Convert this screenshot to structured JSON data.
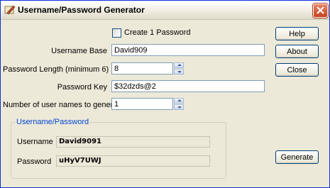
{
  "window": {
    "title": "Username/Password Generator"
  },
  "form": {
    "create_one_label": "Create 1 Password",
    "username_base_label": "Username Base",
    "username_base_value": "David909",
    "password_length_label": "Password Length (minimum 6)",
    "password_length_value": "8",
    "password_key_label": "Password Key",
    "password_key_value": "$32dzds@2",
    "num_usernames_label": "Number of user names to generate",
    "num_usernames_value": "1"
  },
  "buttons": {
    "help": "Help",
    "about": "About",
    "close": "Close",
    "generate": "Generate"
  },
  "result": {
    "group_label": "Username/Password",
    "username_label": "Username",
    "username_value": "David9091",
    "password_label": "Password",
    "password_value": "uHyV7UWJ"
  },
  "colors": {
    "title_border": "#0831d9",
    "group_label": "#0046d5",
    "window_bg": "#ece9d8"
  }
}
